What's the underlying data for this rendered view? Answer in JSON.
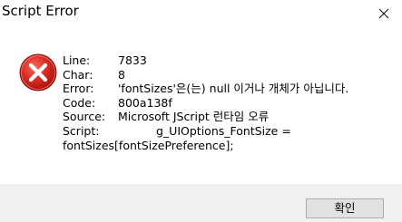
{
  "window": {
    "title": "Script Error",
    "close_icon": "close-icon"
  },
  "error_icon": "error-icon",
  "details": {
    "line_label": "Line:",
    "line_value": "7833",
    "char_label": "Char:",
    "char_value": "8",
    "error_label": "Error:",
    "error_value": "'fontSizes'은(는) null 이거나 개체가 아닙니다.",
    "code_label": "Code:",
    "code_value": "800a138f",
    "source_label": "Source:",
    "source_value": "Microsoft JScript 런타임 오류",
    "script_label": "Script:",
    "script_value": "g_UIOptions_FontSize =",
    "script_continuation": "fontSizes[fontSizePreference];"
  },
  "buttons": {
    "ok_label": "확인"
  }
}
